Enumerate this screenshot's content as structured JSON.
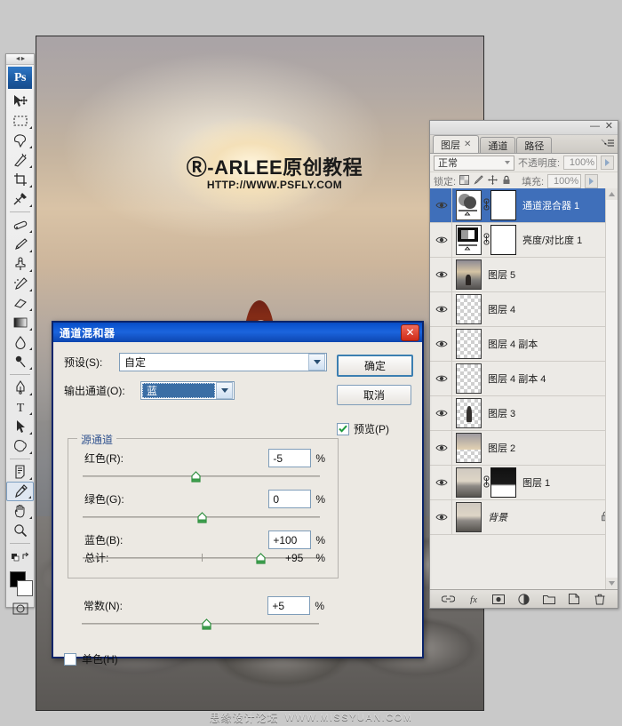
{
  "app": {
    "logo": "Ps",
    "grip": "◄►"
  },
  "canvas": {
    "watermark": {
      "registered": "Ⓡ",
      "line1": "-ARLEE原创教程",
      "line2": "HTTP://WWW.PSFLY.COM"
    }
  },
  "bottom_watermark": {
    "cn": "思缘设计论坛",
    "en": "WWW.MISSYUAN.COM"
  },
  "toolbox": {
    "tools": [
      {
        "name": "move-tool",
        "glyph": "move"
      },
      {
        "name": "marquee-tool",
        "glyph": "marquee"
      },
      {
        "name": "lasso-tool",
        "glyph": "lasso"
      },
      {
        "name": "magic-wand-tool",
        "glyph": "wand"
      },
      {
        "name": "crop-tool",
        "glyph": "crop"
      },
      {
        "name": "slice-tool",
        "glyph": "slice"
      },
      {
        "name": "healing-brush-tool",
        "glyph": "heal"
      },
      {
        "name": "brush-tool",
        "glyph": "brush"
      },
      {
        "name": "clone-stamp-tool",
        "glyph": "stamp"
      },
      {
        "name": "history-brush-tool",
        "glyph": "history"
      },
      {
        "name": "eraser-tool",
        "glyph": "eraser"
      },
      {
        "name": "gradient-tool",
        "glyph": "gradient"
      },
      {
        "name": "blur-tool",
        "glyph": "blur"
      },
      {
        "name": "dodge-tool",
        "glyph": "dodge"
      },
      {
        "name": "pen-tool",
        "glyph": "pen"
      },
      {
        "name": "type-tool",
        "glyph": "T"
      },
      {
        "name": "path-selection-tool",
        "glyph": "arrow"
      },
      {
        "name": "shape-tool",
        "glyph": "shape"
      },
      {
        "name": "notes-tool",
        "glyph": "notes"
      },
      {
        "name": "eyedropper-tool",
        "glyph": "eyedropper"
      },
      {
        "name": "hand-tool",
        "glyph": "hand"
      },
      {
        "name": "zoom-tool",
        "glyph": "zoom"
      }
    ],
    "foreground_color": "#000000",
    "background_color": "#ffffff"
  },
  "layers_panel": {
    "tabs": [
      {
        "label": "图层",
        "active": true,
        "closable": true
      },
      {
        "label": "通道",
        "active": false,
        "closable": false
      },
      {
        "label": "路径",
        "active": false,
        "closable": false
      }
    ],
    "blend_mode": "正常",
    "opacity_label": "不透明度:",
    "opacity_value": "100%",
    "lock_label": "锁定:",
    "fill_label": "填充:",
    "fill_value": "100%",
    "layers": [
      {
        "name": "通道混合器 1",
        "selected": true,
        "visible": true,
        "kind": "adjustment-channel-mixer",
        "has_mask": true,
        "linked": true,
        "locked": false
      },
      {
        "name": "亮度/对比度 1",
        "selected": false,
        "visible": true,
        "kind": "adjustment-brightness-contrast",
        "has_mask": true,
        "linked": true,
        "locked": false
      },
      {
        "name": "图层 5",
        "selected": false,
        "visible": true,
        "kind": "image",
        "has_mask": false,
        "linked": false,
        "locked": false
      },
      {
        "name": "图层 4",
        "selected": false,
        "visible": true,
        "kind": "transparent",
        "has_mask": false,
        "linked": false,
        "locked": false
      },
      {
        "name": "图层 4 副本",
        "selected": false,
        "visible": true,
        "kind": "transparent",
        "has_mask": false,
        "linked": false,
        "locked": false
      },
      {
        "name": "图层 4 副本 4",
        "selected": false,
        "visible": true,
        "kind": "transparent",
        "has_mask": false,
        "linked": false,
        "locked": false
      },
      {
        "name": "图层 3",
        "selected": false,
        "visible": true,
        "kind": "figure",
        "has_mask": false,
        "linked": false,
        "locked": false
      },
      {
        "name": "图层 2",
        "selected": false,
        "visible": true,
        "kind": "sky",
        "has_mask": false,
        "linked": false,
        "locked": false
      },
      {
        "name": "图层 1",
        "selected": false,
        "visible": true,
        "kind": "rock",
        "has_mask": true,
        "linked": true,
        "locked": false
      },
      {
        "name": "背景",
        "selected": false,
        "visible": true,
        "kind": "rock",
        "has_mask": false,
        "linked": false,
        "locked": true
      }
    ],
    "bottom_buttons": [
      {
        "name": "link-layers-button",
        "glyph": "link"
      },
      {
        "name": "layer-style-button",
        "glyph": "fx"
      },
      {
        "name": "add-mask-button",
        "glyph": "mask"
      },
      {
        "name": "adjustment-layer-button",
        "glyph": "halfcircle"
      },
      {
        "name": "new-group-button",
        "glyph": "folder"
      },
      {
        "name": "new-layer-button",
        "glyph": "page"
      },
      {
        "name": "delete-layer-button",
        "glyph": "trash"
      }
    ]
  },
  "dialog": {
    "title": "通道混和器",
    "close_label": "✕",
    "preset_label": "预设(S):",
    "preset_value": "自定",
    "output_channel_label": "输出通道(O):",
    "output_channel_value": "蓝",
    "ok_label": "确定",
    "cancel_label": "取消",
    "preview_label": "预览(P)",
    "preview_checked": true,
    "source_group_title": "源通道",
    "sliders": [
      {
        "label": "红色(R):",
        "value": "-5",
        "unit": "%",
        "pos_pct": 47.5
      },
      {
        "label": "绿色(G):",
        "value": "0",
        "unit": "%",
        "pos_pct": 50.0
      },
      {
        "label": "蓝色(B):",
        "value": "+100",
        "unit": "%",
        "pos_pct": 75.0
      }
    ],
    "total_label": "总计:",
    "total_value": "+95",
    "total_unit": "%",
    "constant": {
      "label": "常数(N):",
      "value": "+5",
      "unit": "%",
      "pos_pct": 52.5
    },
    "monochrome": {
      "label": "单色(H)",
      "checked": false
    }
  }
}
